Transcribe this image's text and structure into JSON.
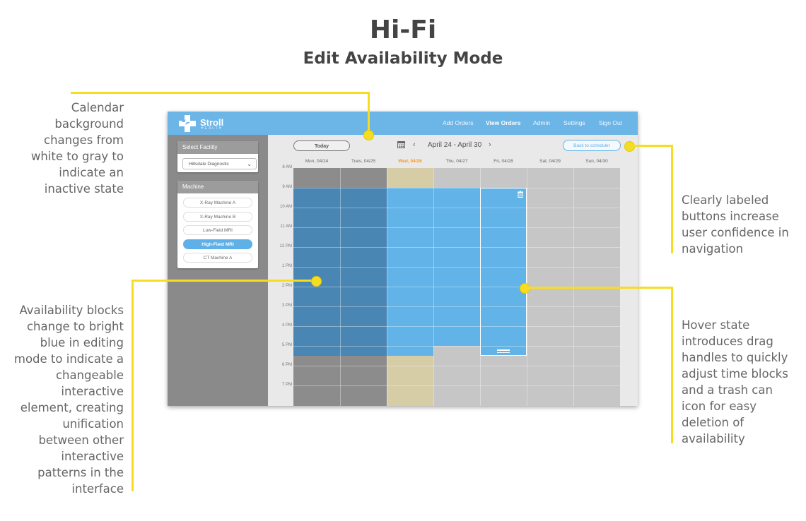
{
  "slide": {
    "title": "Hi-Fi",
    "subtitle": "Edit Availability Mode"
  },
  "annotations": {
    "calendar_bg": [
      "Calendar",
      "background",
      "changes from",
      "white to gray to",
      "indicate an",
      "inactive state"
    ],
    "buttons": [
      "Clearly labeled",
      "buttons increase",
      "user confidence in",
      "navigation"
    ],
    "blocks": [
      "Availability blocks",
      "change to bright",
      "blue in editing",
      "mode to indicate a",
      "changeable",
      "interactive",
      "element, creating",
      "unification",
      "between other",
      "interactive",
      "patterns in the",
      "interface"
    ],
    "hover": [
      "Hover state",
      "introduces drag",
      "handles to quickly",
      "adjust time blocks",
      "and a trash can",
      "icon for easy",
      "deletion of",
      "availability"
    ]
  },
  "app": {
    "brand": "Stroll",
    "brand_sub": "HEALTH",
    "nav": [
      {
        "label": "Add Orders",
        "active": false
      },
      {
        "label": "View Orders",
        "active": true
      },
      {
        "label": "Admin",
        "active": false
      },
      {
        "label": "Settings",
        "active": false
      },
      {
        "label": "Sign Out",
        "active": false
      }
    ],
    "facility": {
      "header": "Select Facility",
      "selected": "Hillsdale Diagnostic"
    },
    "machine": {
      "header": "Machine",
      "items": [
        {
          "label": "X-Ray Machine A",
          "active": false
        },
        {
          "label": "X-Ray Machine B",
          "active": false
        },
        {
          "label": "Low-Field MRI",
          "active": false
        },
        {
          "label": "High-Field MRI",
          "active": true
        },
        {
          "label": "CT Machine A",
          "active": false
        }
      ]
    },
    "toolbar": {
      "today": "Today",
      "date_range": "April 24 - April 30",
      "back": "Back to scheduler"
    },
    "days": [
      {
        "label": "Mon, 04/24",
        "current": false
      },
      {
        "label": "Tues, 04/25",
        "current": false
      },
      {
        "label": "Wed, 04/26",
        "current": true
      },
      {
        "label": "Thu, 04/27",
        "current": false
      },
      {
        "label": "Fri, 04/28",
        "current": false
      },
      {
        "label": "Sat, 04/29",
        "current": false
      },
      {
        "label": "Sun, 04/30",
        "current": false
      }
    ],
    "hours": [
      "8 AM",
      "9 AM",
      "10 AM",
      "11 AM",
      "12 PM",
      "1 PM",
      "2 PM",
      "3 PM",
      "4 PM",
      "5 PM",
      "6 PM",
      "7 PM"
    ],
    "colors": {
      "past_available": "#4a86b3",
      "past_unavailable": "#8c8c8c",
      "editable_available": "#62b3e8",
      "today_unavailable": "#d6cca6",
      "future_unavailable": "#c6c6c6",
      "annotation_yellow": "#f7dd22",
      "nav_blue": "#6cb5e7"
    },
    "availability": [
      {
        "day": 0,
        "blocks": [
          {
            "start": 9,
            "end": 17.5,
            "state": "past_available"
          }
        ]
      },
      {
        "day": 1,
        "blocks": [
          {
            "start": 9,
            "end": 17.5,
            "state": "past_available"
          }
        ]
      },
      {
        "day": 2,
        "blocks": [
          {
            "start": 9,
            "end": 17.5,
            "state": "editable_available"
          }
        ]
      },
      {
        "day": 3,
        "blocks": [
          {
            "start": 9,
            "end": 17,
            "state": "editable_available"
          }
        ]
      },
      {
        "day": 4,
        "blocks": [
          {
            "start": 9,
            "end": 17.5,
            "state": "editable_available",
            "hover": true
          }
        ]
      },
      {
        "day": 5,
        "blocks": []
      },
      {
        "day": 6,
        "blocks": []
      }
    ]
  }
}
